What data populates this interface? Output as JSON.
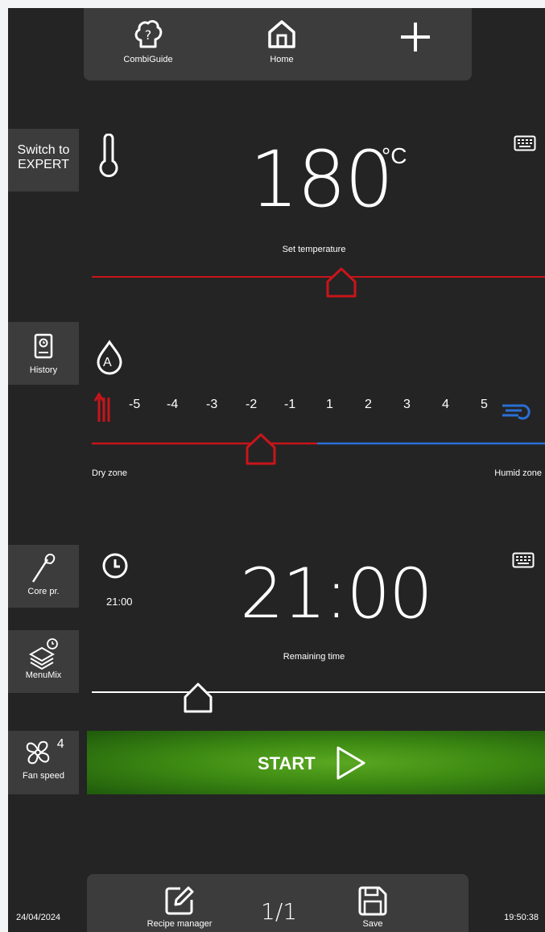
{
  "topbar": {
    "combiguide_label": "CombiGuide",
    "home_label": "Home"
  },
  "sidebar": {
    "switch_expert_line1": "Switch to",
    "switch_expert_line2": "EXPERT",
    "history_label": "History",
    "core_probe_label": "Core pr.",
    "menumix_label": "MenuMix",
    "fan_speed_label": "Fan speed",
    "fan_speed_value": "4"
  },
  "temperature": {
    "value": "180",
    "unit": "°C",
    "caption": "Set temperature",
    "slider_position": 0.57,
    "accent_color": "#c8151b"
  },
  "humidity": {
    "mode_icon_letter": "A",
    "scale": [
      "-5",
      "-4",
      "-3",
      "-2",
      "-1",
      "1",
      "2",
      "3",
      "4",
      "5"
    ],
    "selected": "-2",
    "dry_label": "Dry zone",
    "humid_label": "Humid zone",
    "dry_color": "#c8151b",
    "humid_color": "#2a6fd6"
  },
  "time": {
    "small_value": "21:00",
    "value": "21:00",
    "caption": "Remaining time",
    "slider_position": 0.24
  },
  "start": {
    "label": "START"
  },
  "bottombar": {
    "recipe_manager_label": "Recipe manager",
    "page_indicator": "1/1",
    "save_label": "Save"
  },
  "status": {
    "date": "24/04/2024",
    "time": "19:50:38"
  }
}
